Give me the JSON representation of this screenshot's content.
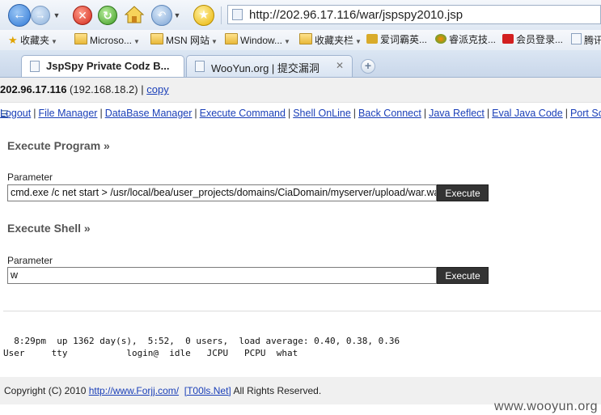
{
  "browser": {
    "url": "http://202.96.17.116/war/jspspy2010.jsp",
    "favorites": [
      {
        "label": "收藏夹",
        "type": "star",
        "dropdown": true
      },
      {
        "label": "Microso...",
        "type": "folder",
        "dropdown": true
      },
      {
        "label": "MSN 网站",
        "type": "folder",
        "dropdown": true
      },
      {
        "label": "Window...",
        "type": "folder",
        "dropdown": true
      },
      {
        "label": "收藏夹栏",
        "type": "folder",
        "dropdown": true
      },
      {
        "label": "爱词霸英...",
        "type": "site",
        "dropdown": false
      },
      {
        "label": "睿派克技...",
        "type": "site",
        "dropdown": false
      },
      {
        "label": "会员登录...",
        "type": "site",
        "dropdown": false
      },
      {
        "label": "腾讯",
        "type": "site",
        "dropdown": false
      }
    ],
    "tabs": [
      {
        "label": "JspSpy Private Codz B...",
        "active": true
      },
      {
        "label": "WooYun.org | 提交漏洞",
        "active": false
      }
    ]
  },
  "info": {
    "ip": "202.96.17.116",
    "local_ip": "(192.168.18.2)",
    "separator": "|",
    "copy_label": "copy"
  },
  "menu": [
    "Logout",
    "File Manager",
    "DataBase Manager",
    "Execute Command",
    "Shell OnLine",
    "Back Connect",
    "Java Reflect",
    "Eval Java Code",
    "Port Scan"
  ],
  "program": {
    "heading": "Execute Program »",
    "param_label": "Parameter",
    "value": "cmd.exe /c net start > /usr/local/bea/user_projects/domains/CiaDomain/myserver/upload/war.war",
    "button": "Execute"
  },
  "shell": {
    "heading": "Execute Shell »",
    "param_label": "Parameter",
    "value": "w",
    "button": "Execute"
  },
  "output": {
    "line1": "  8:29pm  up 1362 day(s),  5:52,  0 users,  load average: 0.40, 0.38, 0.36",
    "line2": "User     tty           login@  idle   JCPU   PCPU  what"
  },
  "footer": {
    "prefix": "Copyright (C) 2010 ",
    "link1": "http://www.Forjj.com/",
    "link2": "[T00ls.Net]",
    "suffix": " All Rights Reserved."
  },
  "watermark": "www.wooyun.org"
}
